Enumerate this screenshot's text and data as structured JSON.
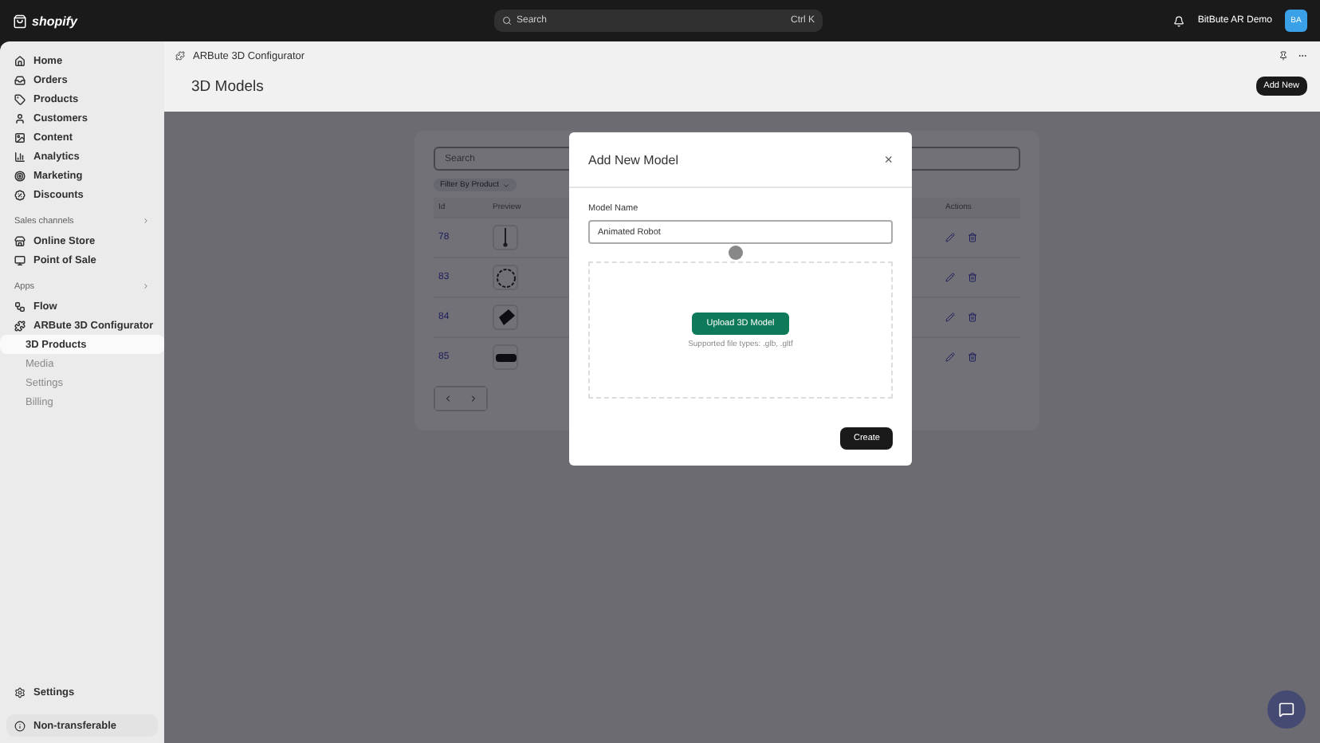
{
  "topbar": {
    "logo": "shopify",
    "search": {
      "placeholder": "Search",
      "shortcut": "Ctrl K"
    },
    "store": "BitBute AR Demo",
    "avatar": "BA"
  },
  "sidebar": {
    "items": [
      {
        "label": "Home"
      },
      {
        "label": "Orders"
      },
      {
        "label": "Products"
      },
      {
        "label": "Customers"
      },
      {
        "label": "Content"
      },
      {
        "label": "Analytics"
      },
      {
        "label": "Marketing"
      },
      {
        "label": "Discounts"
      }
    ],
    "sales_channels": {
      "heading": "Sales channels",
      "items": [
        {
          "label": "Online Store"
        },
        {
          "label": "Point of Sale"
        }
      ]
    },
    "apps": {
      "heading": "Apps",
      "items": [
        {
          "label": "Flow"
        },
        {
          "label": "ARBute 3D Configurator",
          "children": [
            {
              "label": "3D Products",
              "selected": true
            },
            {
              "label": "Media",
              "selected": false
            },
            {
              "label": "Settings",
              "selected": false
            },
            {
              "label": "Billing",
              "selected": false
            }
          ]
        }
      ]
    },
    "settings": "Settings",
    "footer": "Non-transferable"
  },
  "app_header": {
    "breadcrumb": "ARBute 3D Configurator",
    "title": "3D Models",
    "add_button": "Add New"
  },
  "table": {
    "search_placeholder": "Search",
    "filter": "Filter By Product",
    "columns": [
      "Id",
      "Preview",
      "Actions"
    ],
    "rows": [
      {
        "id": "78"
      },
      {
        "id": "83"
      },
      {
        "id": "84"
      },
      {
        "id": "85"
      }
    ]
  },
  "dialog": {
    "title": "Add New Model",
    "close": "×",
    "field_label": "Model Name",
    "field_value": "Animated Robot",
    "upload_button": "Upload 3D Model",
    "upload_hint": "Supported file types: .glb, .gltf",
    "create_button": "Create"
  }
}
